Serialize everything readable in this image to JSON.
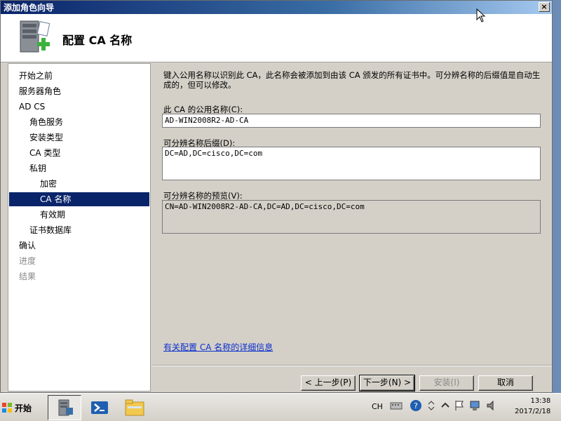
{
  "window": {
    "title": "添加角色向导",
    "close_label": "×",
    "page_title": "配置 CA 名称"
  },
  "nav": {
    "items": [
      {
        "label": "开始之前",
        "indent": 0,
        "state": "normal"
      },
      {
        "label": "服务器角色",
        "indent": 0,
        "state": "normal"
      },
      {
        "label": "AD CS",
        "indent": 0,
        "state": "normal"
      },
      {
        "label": "角色服务",
        "indent": 1,
        "state": "normal"
      },
      {
        "label": "安装类型",
        "indent": 1,
        "state": "normal"
      },
      {
        "label": "CA 类型",
        "indent": 1,
        "state": "normal"
      },
      {
        "label": "私钥",
        "indent": 1,
        "state": "normal"
      },
      {
        "label": "加密",
        "indent": 2,
        "state": "normal"
      },
      {
        "label": "CA 名称",
        "indent": 2,
        "state": "selected"
      },
      {
        "label": "有效期",
        "indent": 2,
        "state": "normal"
      },
      {
        "label": "证书数据库",
        "indent": 1,
        "state": "normal"
      },
      {
        "label": "确认",
        "indent": 0,
        "state": "normal"
      },
      {
        "label": "进度",
        "indent": 0,
        "state": "disabled"
      },
      {
        "label": "结果",
        "indent": 0,
        "state": "disabled"
      }
    ]
  },
  "content": {
    "description": "键入公用名称以识别此 CA，此名称会被添加到由该 CA 颁发的所有证书中。可分辨名称的后缀值是自动生成的，但可以修改。",
    "common_name_label": "此 CA 的公用名称(C):",
    "common_name_value": "AD-WIN2008R2-AD-CA",
    "dn_suffix_label": "可分辨名称后缀(D):",
    "dn_suffix_value": "DC=AD,DC=cisco,DC=com",
    "dn_preview_label": "可分辨名称的预览(V):",
    "dn_preview_value": "CN=AD-WIN2008R2-AD-CA,DC=AD,DC=cisco,DC=com",
    "help_link": "有关配置 CA 名称的详细信息"
  },
  "buttons": {
    "back": "< 上一步(P)",
    "next": "下一步(N) >",
    "install": "安装(I)",
    "cancel": "取消"
  },
  "taskbar": {
    "start_label": "开始",
    "language": "CH",
    "clock_time": "13:38",
    "clock_date": "2017/2/18"
  },
  "colors": {
    "selection": "#0a246a",
    "link": "#0a2ecc",
    "window_bg": "#d4d0c8"
  }
}
